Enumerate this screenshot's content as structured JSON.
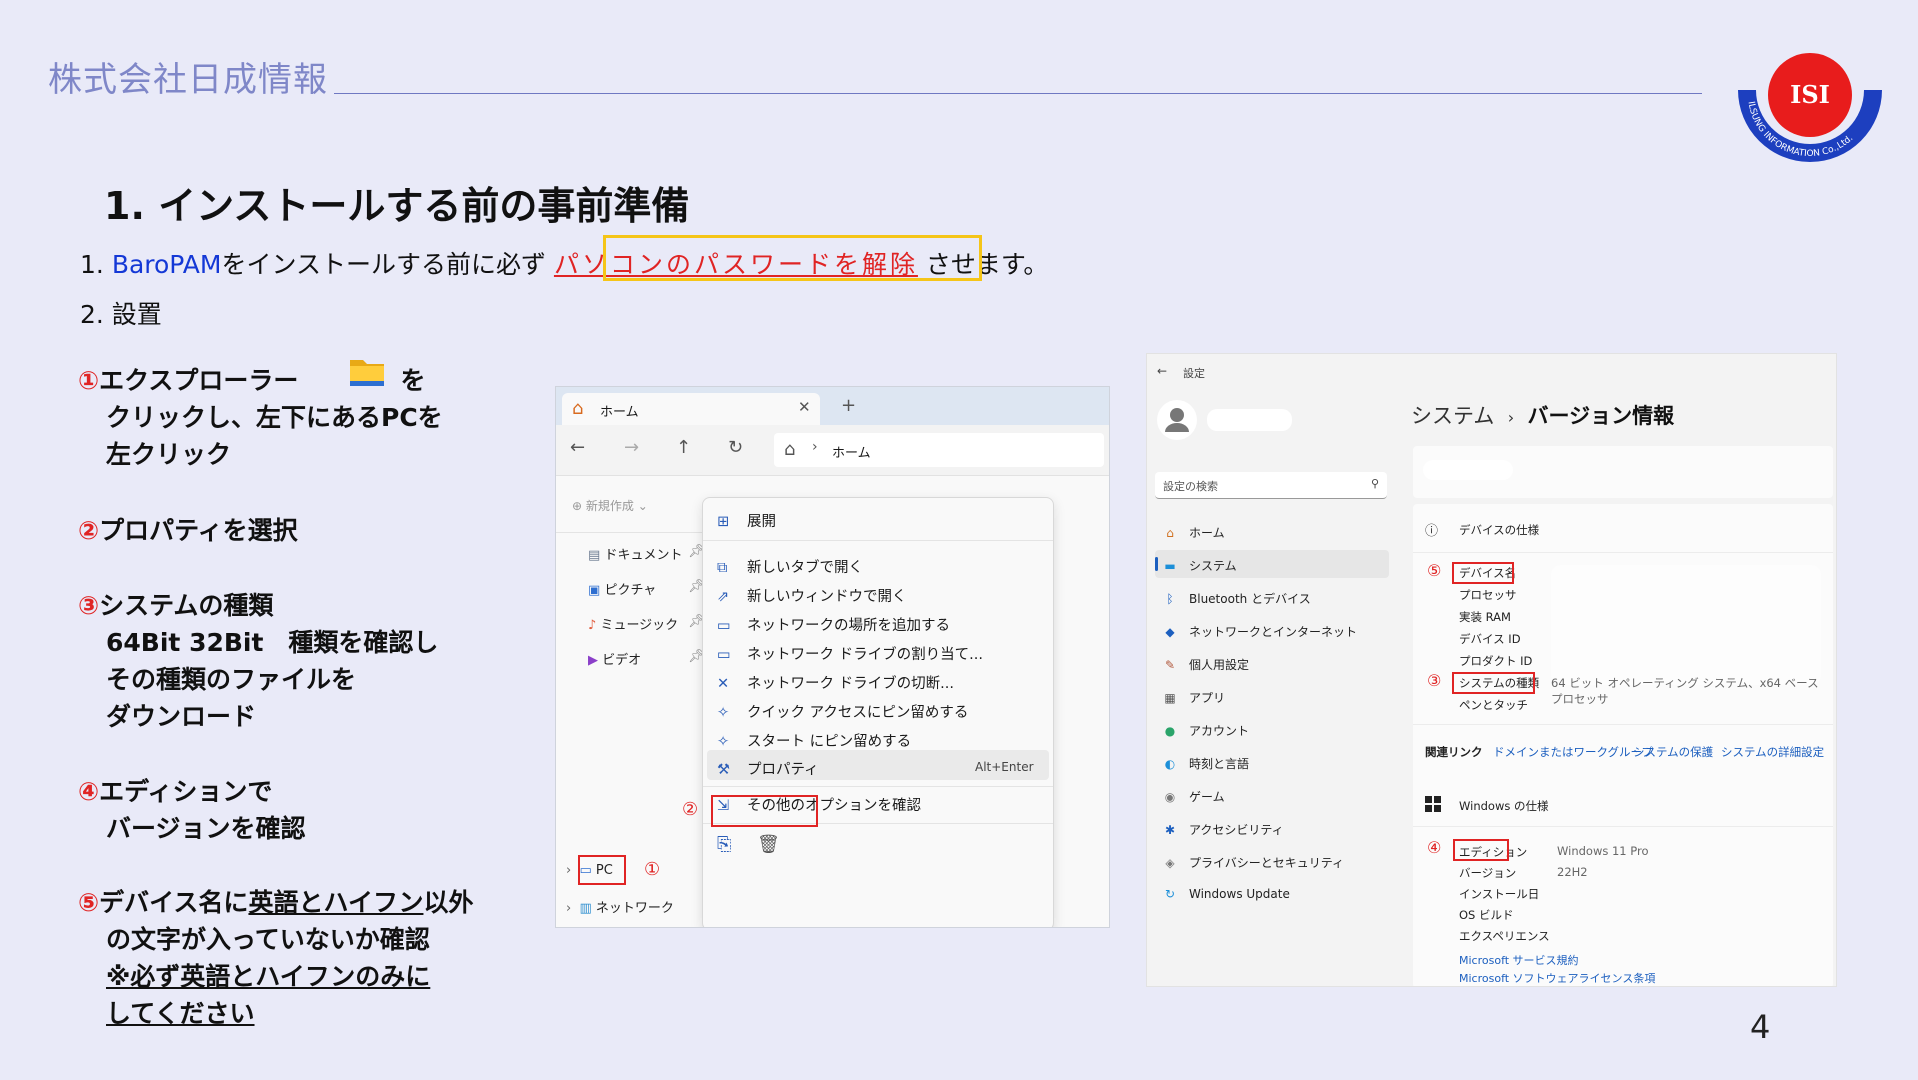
{
  "header": {
    "company": "株式会社日成情報",
    "logo_text": "ISI",
    "logo_ring_text": "ILSUNG INFORMATION Co.,Ltd."
  },
  "title": "1. インストールする前の事前準備",
  "intro": {
    "prefix": "1. ",
    "product": "BaroPAM",
    "middle": "をインストールする前に必ず",
    "highlight": "パソコンのパスワードを解除",
    "suffix": "させます。"
  },
  "section2": "2. 設置",
  "steps": {
    "s1": {
      "num": "①",
      "l1": "エクスプローラー",
      "l1b": "を",
      "l2": "クリックし、左下にあるPCを",
      "l3": "左クリック"
    },
    "s2": {
      "num": "②",
      "l1": "プロパティを選択"
    },
    "s3": {
      "num": "③",
      "l1": "システムの種類",
      "l2": "64Bit 32Bit　種類を確認し",
      "l3": "その種類のファイルを",
      "l4": "ダウンロード"
    },
    "s4": {
      "num": "④",
      "l1": "エディションで",
      "l2": "バージョンを確認"
    },
    "s5": {
      "num": "⑤",
      "l1a": "デバイス名に",
      "l1b": "英語とハイフン",
      "l1c": "以外",
      "l2": "の文字が入っていないか確認",
      "l3": "※必ず英語とハイフンのみに",
      "l4": "してください"
    }
  },
  "explorer": {
    "tab": "ホーム",
    "address": "ホーム",
    "new_btn": "新規作成",
    "sidebar": [
      "ドキュメント",
      "ピクチャ",
      "ミュージック",
      "ビデオ"
    ],
    "pc": "PC",
    "network": "ネットワーク",
    "menu": [
      {
        "label": "展開",
        "icon": "⊞"
      },
      {
        "label": "新しいタブで開く",
        "icon": "⧉"
      },
      {
        "label": "新しいウィンドウで開く",
        "icon": "⇗"
      },
      {
        "label": "ネットワークの場所を追加する",
        "icon": "▭"
      },
      {
        "label": "ネットワーク ドライブの割り当て...",
        "icon": "▭"
      },
      {
        "label": "ネットワーク ドライブの切断...",
        "icon": "✕"
      },
      {
        "label": "クイック アクセスにピン留めする",
        "icon": "✧"
      },
      {
        "label": "スタート にピン留めする",
        "icon": "✧"
      },
      {
        "label": "プロパティ",
        "icon": "🔧",
        "shortcut": "Alt+Enter"
      },
      {
        "label": "その他のオプションを確認",
        "icon": "⇲"
      }
    ],
    "mark1": "①",
    "mark2": "②"
  },
  "settings": {
    "app_title": "設定",
    "search_placeholder": "設定の検索",
    "breadcrumb_a": "システム",
    "breadcrumb_sep": "›",
    "breadcrumb_b": "バージョン情報",
    "nav": [
      {
        "label": "ホーム",
        "icon": "⌂"
      },
      {
        "label": "システム",
        "icon": "▬"
      },
      {
        "label": "Bluetooth とデバイス",
        "icon": "ᛒ"
      },
      {
        "label": "ネットワークとインターネット",
        "icon": "◆"
      },
      {
        "label": "個人用設定",
        "icon": "✎"
      },
      {
        "label": "アプリ",
        "icon": "▦"
      },
      {
        "label": "アカウント",
        "icon": "●"
      },
      {
        "label": "時刻と言語",
        "icon": "◐"
      },
      {
        "label": "ゲーム",
        "icon": "◉"
      },
      {
        "label": "アクセシビリティ",
        "icon": "✱"
      },
      {
        "label": "プライバシーとセキュリティ",
        "icon": "◈"
      },
      {
        "label": "Windows Update",
        "icon": "↻"
      }
    ],
    "device_spec_title": "デバイスの仕様",
    "device_rows": [
      "デバイス名",
      "プロセッサ",
      "実装 RAM",
      "デバイス ID",
      "プロダクト ID",
      "システムの種類",
      "ペンとタッチ"
    ],
    "system_type_value": "64 ビット オペレーティング システム、x64 ベース プロセッサ",
    "related_label": "関連リンク",
    "related_links": [
      "ドメインまたはワークグループ",
      "システムの保護",
      "システムの詳細設定"
    ],
    "win_spec_title": "Windows の仕様",
    "win_rows": [
      "エディション",
      "バージョン",
      "インストール日",
      "OS ビルド",
      "エクスペリエンス"
    ],
    "edition_value": "Windows 11 Pro",
    "version_value": "22H2",
    "links": [
      "Microsoft サービス規約",
      "Microsoft ソフトウェアライセンス条項"
    ],
    "mark3": "③",
    "mark4": "④",
    "mark5": "⑤"
  },
  "page_number": "4",
  "colors": {
    "background": "#e9eaf8",
    "accent_red": "#e02424",
    "highlight_yellow": "#f5c518",
    "blue_text": "#1438d6",
    "company": "#7f87c8"
  }
}
